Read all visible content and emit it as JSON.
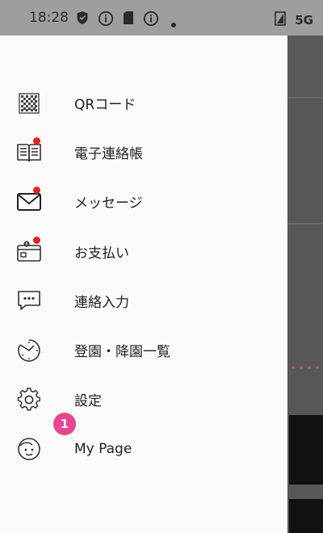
{
  "status_bar": {
    "time": "18:28",
    "icons": [
      "shield-icon",
      "info-icon",
      "sd-card-icon",
      "info-icon",
      "dot-icon"
    ],
    "right": "5G"
  },
  "menu": {
    "items": [
      {
        "label": "QRコード",
        "icon": "qr-code-icon",
        "has_dot": false
      },
      {
        "label": "電子連絡帳",
        "icon": "book-icon",
        "has_dot": true
      },
      {
        "label": "メッセージ",
        "icon": "envelope-icon",
        "has_dot": true
      },
      {
        "label": "お支払い",
        "icon": "wallet-icon",
        "has_dot": true
      },
      {
        "label": "連絡入力",
        "icon": "chat-icon",
        "has_dot": false
      },
      {
        "label": "登園・降園一覧",
        "icon": "clock-icon",
        "has_dot": false
      },
      {
        "label": "設定",
        "icon": "gear-icon",
        "has_dot": false
      },
      {
        "label": "My Page",
        "icon": "face-icon",
        "has_dot": false,
        "badge": "1"
      }
    ]
  },
  "colors": {
    "dot": "#e8201e",
    "badge": "#e8458f",
    "drawer_bg": "#fafafa",
    "status_bar": "#9e9e9e"
  }
}
